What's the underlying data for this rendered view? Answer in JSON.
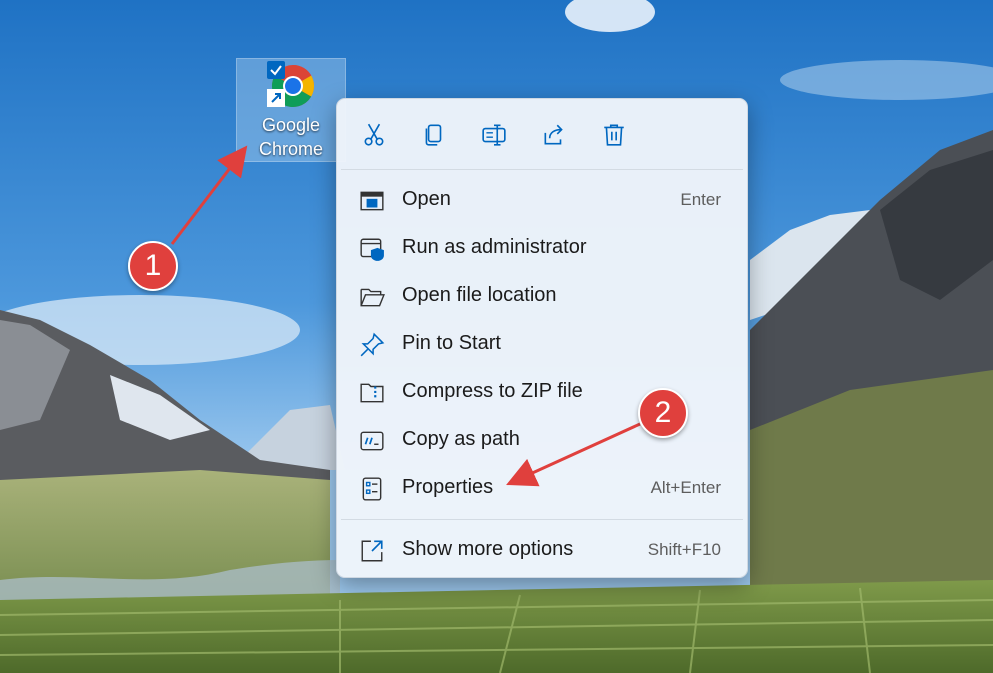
{
  "desktop": {
    "icon": {
      "label_line1": "Google",
      "label_line2": "Chrome",
      "icon": "chrome-icon"
    }
  },
  "context_menu": {
    "quick_actions": [
      {
        "name": "cut",
        "icon": "scissors-icon"
      },
      {
        "name": "copy",
        "icon": "copy-icon"
      },
      {
        "name": "rename",
        "icon": "rename-icon"
      },
      {
        "name": "share",
        "icon": "share-icon"
      },
      {
        "name": "delete",
        "icon": "trash-icon"
      }
    ],
    "items": [
      {
        "label": "Open",
        "shortcut": "Enter",
        "icon": "open-window-icon"
      },
      {
        "label": "Run as administrator",
        "shortcut": "",
        "icon": "shield-icon"
      },
      {
        "label": "Open file location",
        "shortcut": "",
        "icon": "folder-icon"
      },
      {
        "label": "Pin to Start",
        "shortcut": "",
        "icon": "pin-icon"
      },
      {
        "label": "Compress to ZIP file",
        "shortcut": "",
        "icon": "zip-folder-icon"
      },
      {
        "label": "Copy as path",
        "shortcut": "",
        "icon": "copy-path-icon"
      },
      {
        "label": "Properties",
        "shortcut": "Alt+Enter",
        "icon": "properties-icon"
      },
      {
        "label": "Show more options",
        "shortcut": "Shift+F10",
        "icon": "more-options-icon"
      }
    ]
  },
  "annotations": [
    {
      "number": "1",
      "target": "desktop-icon"
    },
    {
      "number": "2",
      "target": "properties"
    }
  ],
  "colors": {
    "accent": "#0067c0",
    "badge": "#e0403d",
    "arrow": "#e0403d",
    "menu_bg": "#eef4fa"
  }
}
